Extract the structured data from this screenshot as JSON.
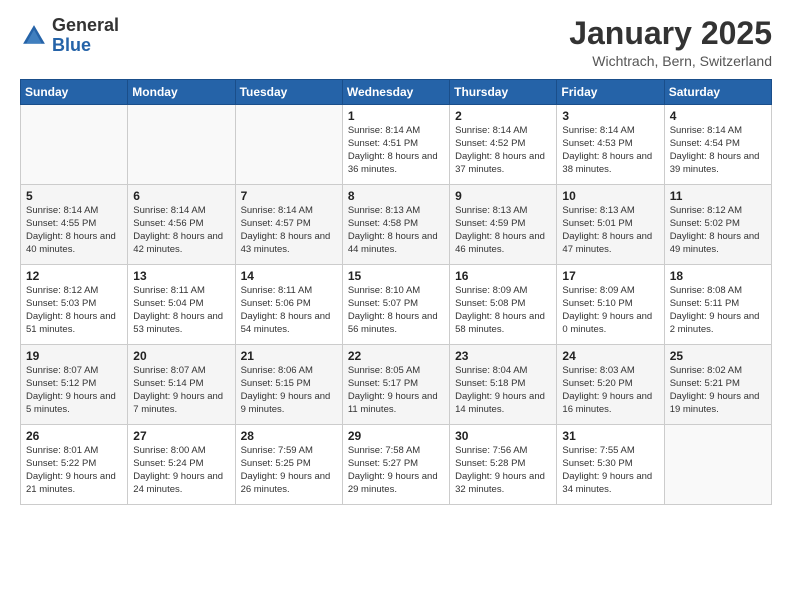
{
  "logo": {
    "general": "General",
    "blue": "Blue"
  },
  "header": {
    "title": "January 2025",
    "subtitle": "Wichtrach, Bern, Switzerland"
  },
  "weekdays": [
    "Sunday",
    "Monday",
    "Tuesday",
    "Wednesday",
    "Thursday",
    "Friday",
    "Saturday"
  ],
  "weeks": [
    [
      {
        "day": "",
        "info": ""
      },
      {
        "day": "",
        "info": ""
      },
      {
        "day": "",
        "info": ""
      },
      {
        "day": "1",
        "info": "Sunrise: 8:14 AM\nSunset: 4:51 PM\nDaylight: 8 hours and 36 minutes."
      },
      {
        "day": "2",
        "info": "Sunrise: 8:14 AM\nSunset: 4:52 PM\nDaylight: 8 hours and 37 minutes."
      },
      {
        "day": "3",
        "info": "Sunrise: 8:14 AM\nSunset: 4:53 PM\nDaylight: 8 hours and 38 minutes."
      },
      {
        "day": "4",
        "info": "Sunrise: 8:14 AM\nSunset: 4:54 PM\nDaylight: 8 hours and 39 minutes."
      }
    ],
    [
      {
        "day": "5",
        "info": "Sunrise: 8:14 AM\nSunset: 4:55 PM\nDaylight: 8 hours and 40 minutes."
      },
      {
        "day": "6",
        "info": "Sunrise: 8:14 AM\nSunset: 4:56 PM\nDaylight: 8 hours and 42 minutes."
      },
      {
        "day": "7",
        "info": "Sunrise: 8:14 AM\nSunset: 4:57 PM\nDaylight: 8 hours and 43 minutes."
      },
      {
        "day": "8",
        "info": "Sunrise: 8:13 AM\nSunset: 4:58 PM\nDaylight: 8 hours and 44 minutes."
      },
      {
        "day": "9",
        "info": "Sunrise: 8:13 AM\nSunset: 4:59 PM\nDaylight: 8 hours and 46 minutes."
      },
      {
        "day": "10",
        "info": "Sunrise: 8:13 AM\nSunset: 5:01 PM\nDaylight: 8 hours and 47 minutes."
      },
      {
        "day": "11",
        "info": "Sunrise: 8:12 AM\nSunset: 5:02 PM\nDaylight: 8 hours and 49 minutes."
      }
    ],
    [
      {
        "day": "12",
        "info": "Sunrise: 8:12 AM\nSunset: 5:03 PM\nDaylight: 8 hours and 51 minutes."
      },
      {
        "day": "13",
        "info": "Sunrise: 8:11 AM\nSunset: 5:04 PM\nDaylight: 8 hours and 53 minutes."
      },
      {
        "day": "14",
        "info": "Sunrise: 8:11 AM\nSunset: 5:06 PM\nDaylight: 8 hours and 54 minutes."
      },
      {
        "day": "15",
        "info": "Sunrise: 8:10 AM\nSunset: 5:07 PM\nDaylight: 8 hours and 56 minutes."
      },
      {
        "day": "16",
        "info": "Sunrise: 8:09 AM\nSunset: 5:08 PM\nDaylight: 8 hours and 58 minutes."
      },
      {
        "day": "17",
        "info": "Sunrise: 8:09 AM\nSunset: 5:10 PM\nDaylight: 9 hours and 0 minutes."
      },
      {
        "day": "18",
        "info": "Sunrise: 8:08 AM\nSunset: 5:11 PM\nDaylight: 9 hours and 2 minutes."
      }
    ],
    [
      {
        "day": "19",
        "info": "Sunrise: 8:07 AM\nSunset: 5:12 PM\nDaylight: 9 hours and 5 minutes."
      },
      {
        "day": "20",
        "info": "Sunrise: 8:07 AM\nSunset: 5:14 PM\nDaylight: 9 hours and 7 minutes."
      },
      {
        "day": "21",
        "info": "Sunrise: 8:06 AM\nSunset: 5:15 PM\nDaylight: 9 hours and 9 minutes."
      },
      {
        "day": "22",
        "info": "Sunrise: 8:05 AM\nSunset: 5:17 PM\nDaylight: 9 hours and 11 minutes."
      },
      {
        "day": "23",
        "info": "Sunrise: 8:04 AM\nSunset: 5:18 PM\nDaylight: 9 hours and 14 minutes."
      },
      {
        "day": "24",
        "info": "Sunrise: 8:03 AM\nSunset: 5:20 PM\nDaylight: 9 hours and 16 minutes."
      },
      {
        "day": "25",
        "info": "Sunrise: 8:02 AM\nSunset: 5:21 PM\nDaylight: 9 hours and 19 minutes."
      }
    ],
    [
      {
        "day": "26",
        "info": "Sunrise: 8:01 AM\nSunset: 5:22 PM\nDaylight: 9 hours and 21 minutes."
      },
      {
        "day": "27",
        "info": "Sunrise: 8:00 AM\nSunset: 5:24 PM\nDaylight: 9 hours and 24 minutes."
      },
      {
        "day": "28",
        "info": "Sunrise: 7:59 AM\nSunset: 5:25 PM\nDaylight: 9 hours and 26 minutes."
      },
      {
        "day": "29",
        "info": "Sunrise: 7:58 AM\nSunset: 5:27 PM\nDaylight: 9 hours and 29 minutes."
      },
      {
        "day": "30",
        "info": "Sunrise: 7:56 AM\nSunset: 5:28 PM\nDaylight: 9 hours and 32 minutes."
      },
      {
        "day": "31",
        "info": "Sunrise: 7:55 AM\nSunset: 5:30 PM\nDaylight: 9 hours and 34 minutes."
      },
      {
        "day": "",
        "info": ""
      }
    ]
  ]
}
